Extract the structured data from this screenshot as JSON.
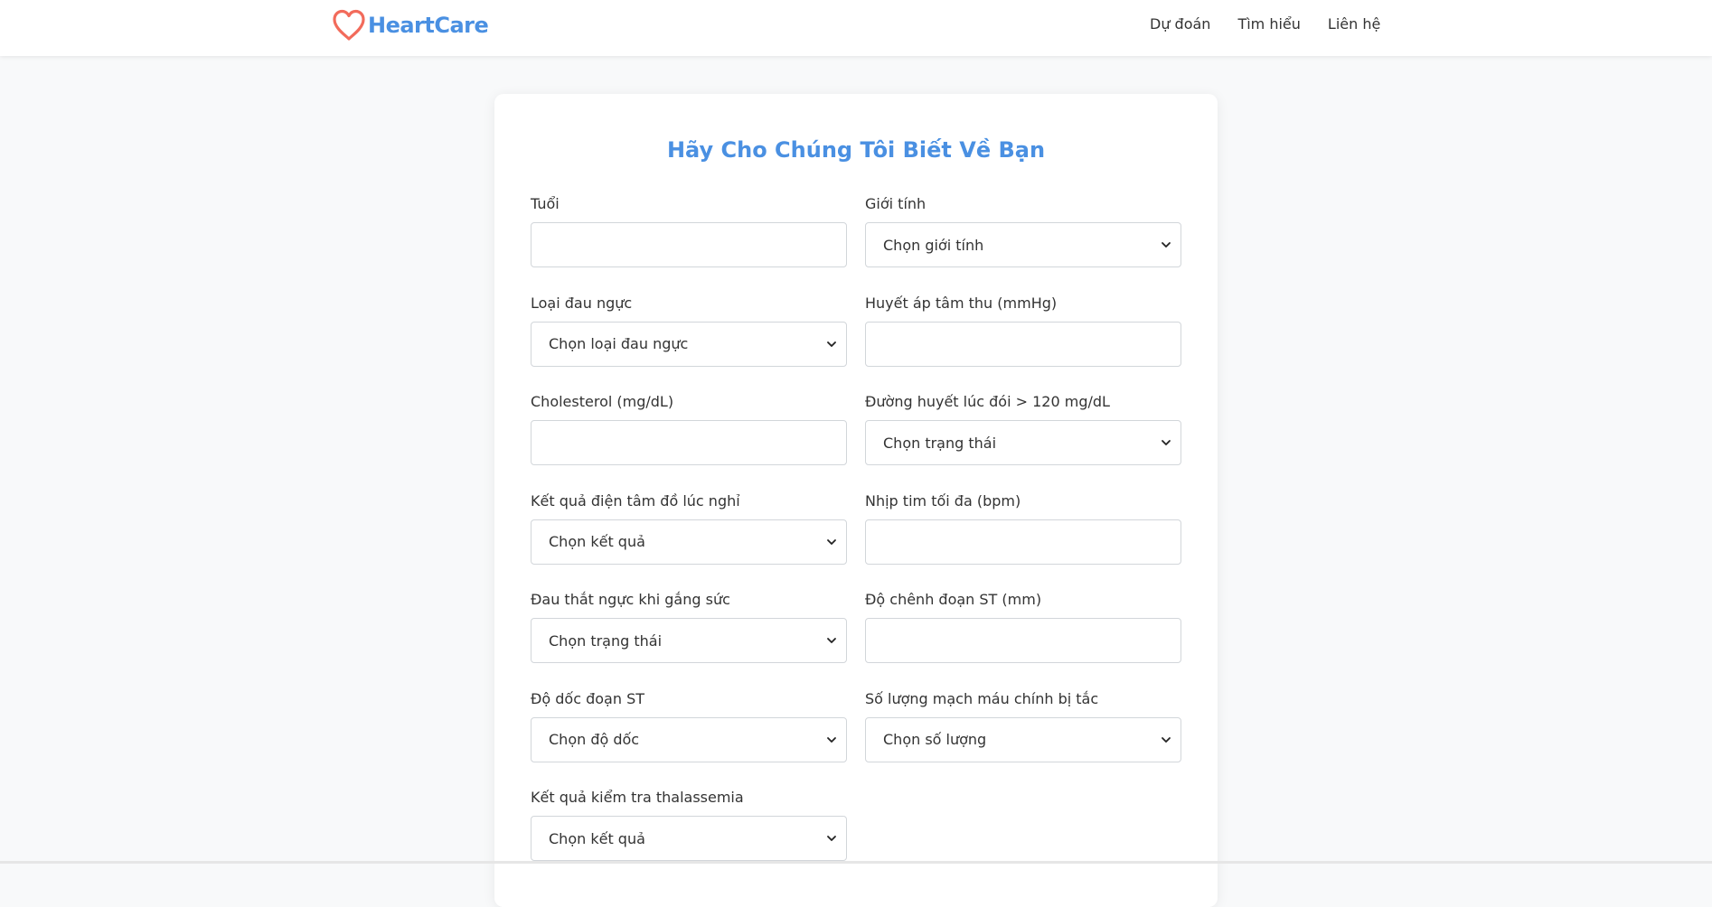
{
  "brand": {
    "name": "HeartCare",
    "logo_icon": "heart-outline-icon",
    "logo_color": "#f26b5b",
    "text_color": "#4a90e2"
  },
  "nav": {
    "items": [
      {
        "label": "Dự đoán"
      },
      {
        "label": "Tìm hiểu"
      },
      {
        "label": "Liên hệ"
      }
    ]
  },
  "form": {
    "title": "Hãy Cho Chúng Tôi Biết Về Bạn",
    "title_color": "#4a90e2",
    "fields": {
      "age": {
        "label": "Tuổi",
        "value": ""
      },
      "sex": {
        "label": "Giới tính",
        "selected": "Chọn giới tính"
      },
      "chest_pain": {
        "label": "Loại đau ngực",
        "selected": "Chọn loại đau ngực"
      },
      "blood_pressure": {
        "label": "Huyết áp tâm thu (mmHg)",
        "value": ""
      },
      "cholesterol": {
        "label": "Cholesterol (mg/dL)",
        "value": ""
      },
      "fasting_sugar": {
        "label": "Đường huyết lúc đói > 120 mg/dL",
        "selected": "Chọn trạng thái"
      },
      "rest_ecg": {
        "label": "Kết quả điện tâm đồ lúc nghỉ",
        "selected": "Chọn kết quả"
      },
      "max_heart_rate": {
        "label": "Nhịp tim tối đa (bpm)",
        "value": ""
      },
      "exercise_angina": {
        "label": "Đau thắt ngực khi gắng sức",
        "selected": "Chọn trạng thái"
      },
      "st_depression": {
        "label": "Độ chênh đoạn ST (mm)",
        "value": ""
      },
      "st_slope": {
        "label": "Độ dốc đoạn ST",
        "selected": "Chọn độ dốc"
      },
      "major_vessels": {
        "label": "Số lượng mạch máu chính bị tắc",
        "selected": "Chọn số lượng"
      },
      "thalassemia": {
        "label": "Kết quả kiểm tra thalassemia",
        "selected": "Chọn kết quả"
      }
    }
  }
}
